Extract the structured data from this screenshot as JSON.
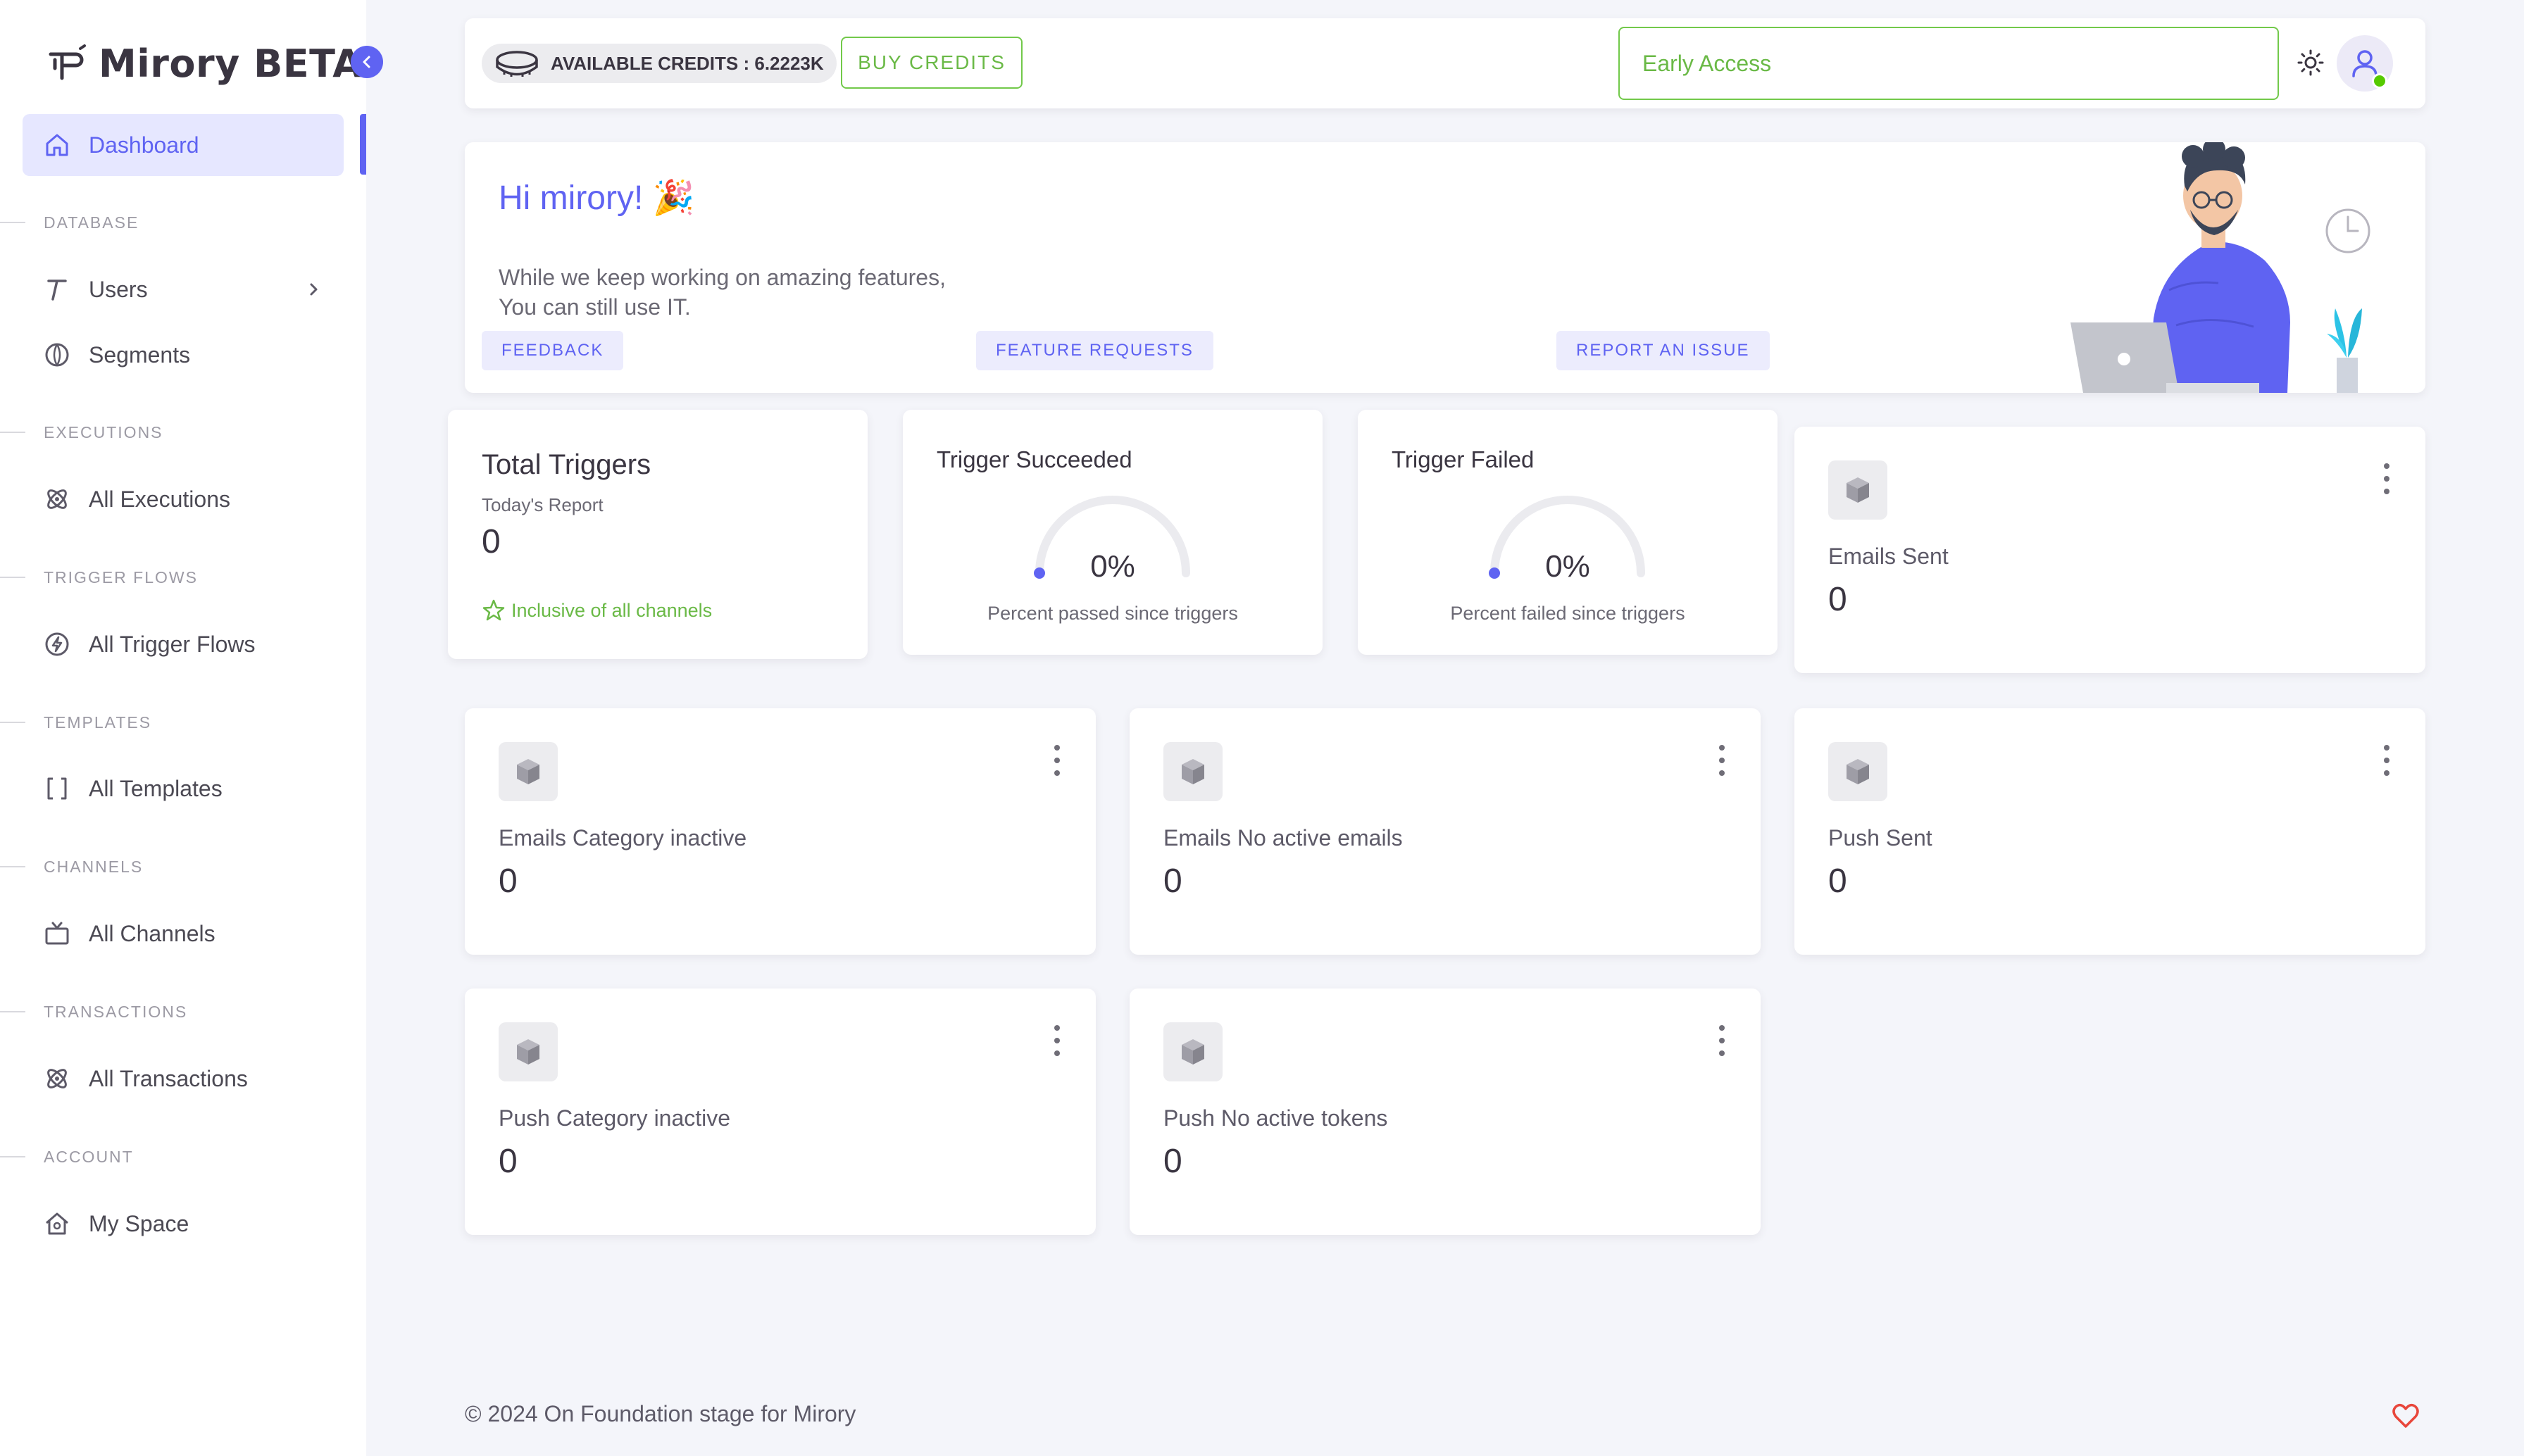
{
  "brand": {
    "title": "Mirory BETA"
  },
  "sidebar": {
    "dashboard": "Dashboard",
    "sections": {
      "database": "DATABASE",
      "executions": "EXECUTIONS",
      "trigger_flows": "TRIGGER FLOWS",
      "templates": "TEMPLATES",
      "channels": "CHANNELS",
      "transactions": "TRANSACTIONS",
      "account": "ACCOUNT"
    },
    "items": {
      "users": "Users",
      "segments": "Segments",
      "all_executions": "All Executions",
      "all_trigger_flows": "All Trigger Flows",
      "all_templates": "All Templates",
      "all_channels": "All Channels",
      "all_transactions": "All Transactions",
      "my_space": "My Space"
    }
  },
  "topbar": {
    "credits": "AVAILABLE CREDITS : 6.2223K",
    "buy_credits": "BUY CREDITS",
    "early_access": "Early Access"
  },
  "welcome": {
    "greeting": "Hi mirory! 🎉",
    "line1": "While we keep working on amazing features,",
    "line2": "You can still use IT.",
    "feedback": "FEEDBACK",
    "feature_requests": "FEATURE REQUESTS",
    "report_issue": "REPORT AN ISSUE"
  },
  "stats": {
    "total_triggers": {
      "title": "Total Triggers",
      "subtitle": "Today's Report",
      "value": "0",
      "note": "Inclusive of all channels"
    },
    "trigger_succeeded": {
      "title": "Trigger Succeeded",
      "percent": "0%",
      "percent_value": 0,
      "caption": "Percent passed since triggers"
    },
    "trigger_failed": {
      "title": "Trigger Failed",
      "percent": "0%",
      "percent_value": 0,
      "caption": "Percent failed since triggers"
    },
    "emails_sent": {
      "label": "Emails Sent",
      "value": "0"
    },
    "emails_category_inactive": {
      "label": "Emails Category inactive",
      "value": "0"
    },
    "emails_no_active": {
      "label": "Emails No active emails",
      "value": "0"
    },
    "push_sent": {
      "label": "Push Sent",
      "value": "0"
    },
    "push_category_inactive": {
      "label": "Push Category inactive",
      "value": "0"
    },
    "push_no_active_tokens": {
      "label": "Push No active tokens",
      "value": "0"
    }
  },
  "footer": {
    "copyright": "© 2024 On Foundation stage for Mirory"
  },
  "colors": {
    "primary": "#5f63f2",
    "success": "#6ab946",
    "danger": "#e8463b"
  }
}
